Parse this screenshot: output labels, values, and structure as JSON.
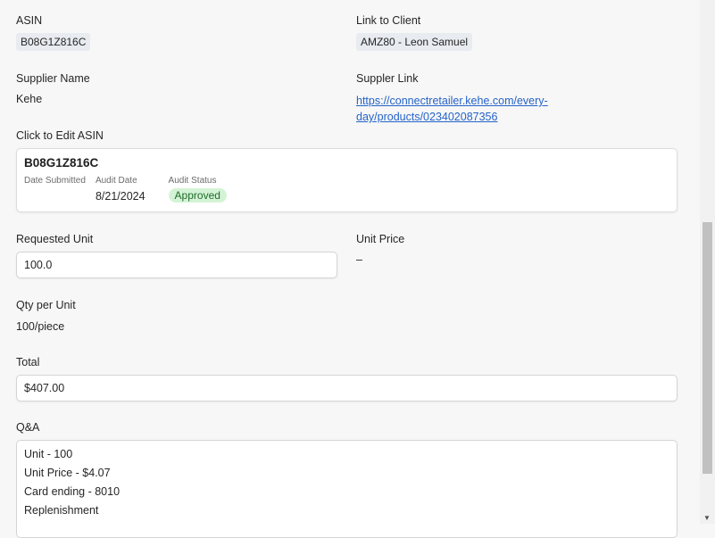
{
  "asin": {
    "label": "ASIN",
    "value": "B08G1Z816C"
  },
  "client": {
    "label": "Link to Client",
    "value": "AMZ80 - Leon Samuel"
  },
  "supplier_name": {
    "label": "Supplier Name",
    "value": "Kehe"
  },
  "supplier_link": {
    "label": "Suppler Link",
    "value": "https://connectretailer.kehe.com/every-day/products/023402087356"
  },
  "edit_asin": {
    "label": "Click to Edit ASIN",
    "title": "B08G1Z816C",
    "date_submitted_label": "Date Submitted",
    "date_submitted_value": "",
    "audit_date_label": "Audit Date",
    "audit_date_value": "8/21/2024",
    "audit_status_label": "Audit Status",
    "audit_status_value": "Approved"
  },
  "requested_unit": {
    "label": "Requested Unit",
    "value": "100.0"
  },
  "unit_price": {
    "label": "Unit Price",
    "value": "–"
  },
  "qty_per_unit": {
    "label": "Qty per Unit",
    "value": "100/piece"
  },
  "total": {
    "label": "Total",
    "value": "$407.00"
  },
  "qa": {
    "label": "Q&A",
    "lines": [
      "Unit - 100",
      "Unit Price - $4.07",
      "Card ending - 8010",
      "Replenishment"
    ]
  },
  "colors": {
    "link": "#2563c8",
    "badge_bg": "#d4f3d6",
    "badge_text": "#1e6b2a",
    "chip_bg": "#e8ebf0"
  }
}
